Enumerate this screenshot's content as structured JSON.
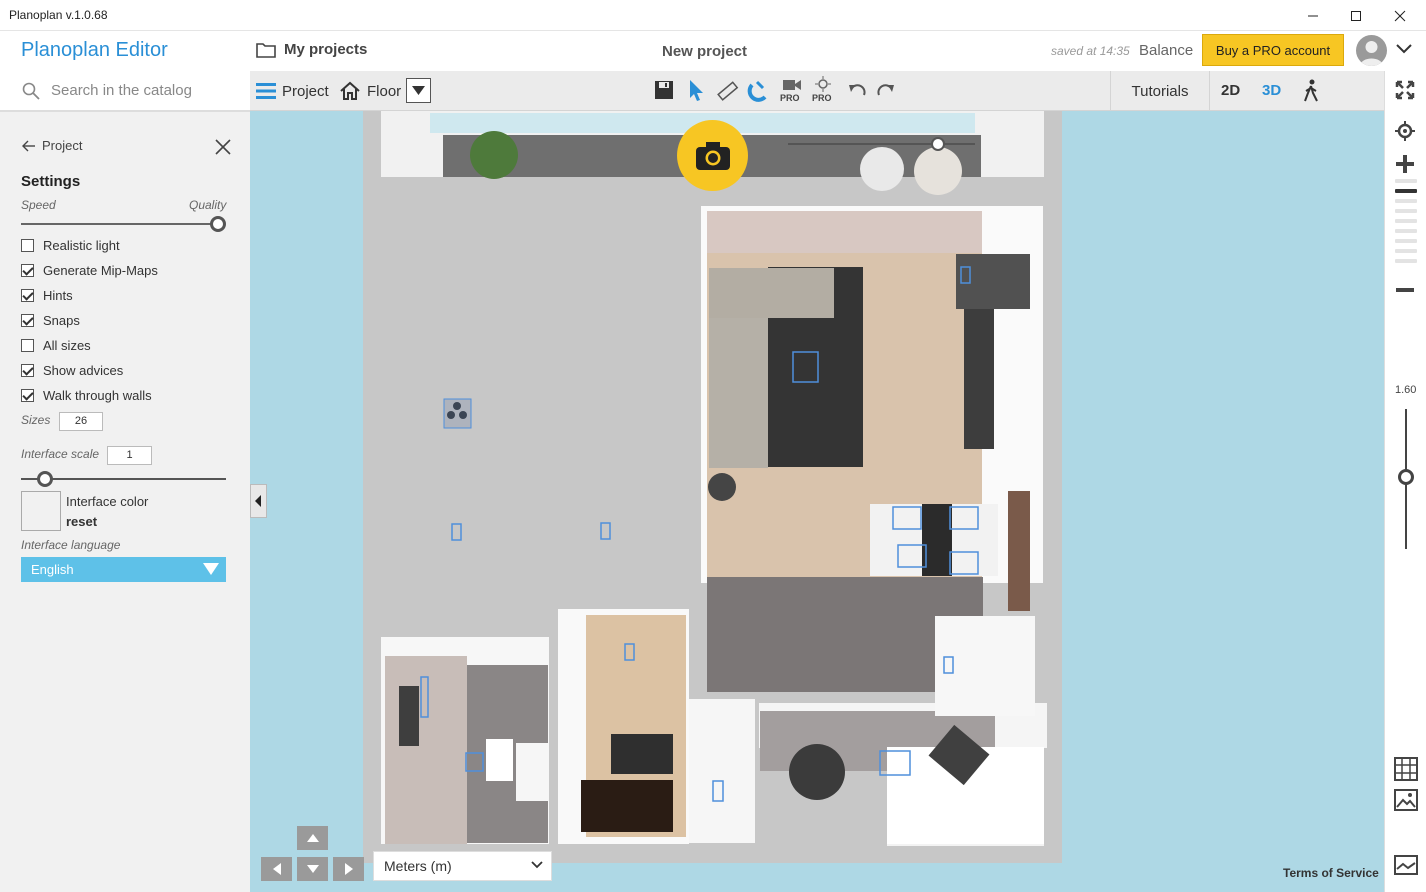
{
  "window": {
    "title": "Planoplan v.1.0.68"
  },
  "header": {
    "brand": "Planoplan Editor",
    "my_projects": "My projects",
    "project_name": "New project",
    "saved": "saved at 14:35",
    "balance": "Balance",
    "buy_pro": "Buy a PRO account"
  },
  "sidebar": {
    "search_placeholder": "Search in the catalog",
    "back_label": "Project",
    "title": "Settings",
    "speed_label": "Speed",
    "quality_label": "Quality",
    "quality_level": 1.0,
    "checkboxes": [
      {
        "label": "Realistic light",
        "checked": false
      },
      {
        "label": "Generate Mip-Maps",
        "checked": true
      },
      {
        "label": "Hints",
        "checked": true
      },
      {
        "label": "Snaps",
        "checked": true
      },
      {
        "label": "All sizes",
        "checked": false
      },
      {
        "label": "Show advices",
        "checked": true
      },
      {
        "label": "Walk through walls",
        "checked": true
      }
    ],
    "sizes_label": "Sizes",
    "sizes_value": "26",
    "interface_scale_label": "Interface scale",
    "interface_scale_value": "1",
    "interface_color_label": "Interface color",
    "interface_color_reset": "reset",
    "interface_language_label": "Interface language",
    "language": "English"
  },
  "toolbar": {
    "project_label": "Project",
    "floor_label": "Floor",
    "pro1": "PRO",
    "pro2": "PRO",
    "tutorials": "Tutorials",
    "view_2d": "2D",
    "view_3d": "3D"
  },
  "rightrail": {
    "zoom_value": "1.60"
  },
  "footer": {
    "units": "Meters (m)",
    "terms": "Terms of Service"
  },
  "colors": {
    "accent": "#2a8fd6",
    "pro_button": "#f7c623",
    "language_select": "#5ec1e8",
    "canvas": "#aed8e5"
  }
}
